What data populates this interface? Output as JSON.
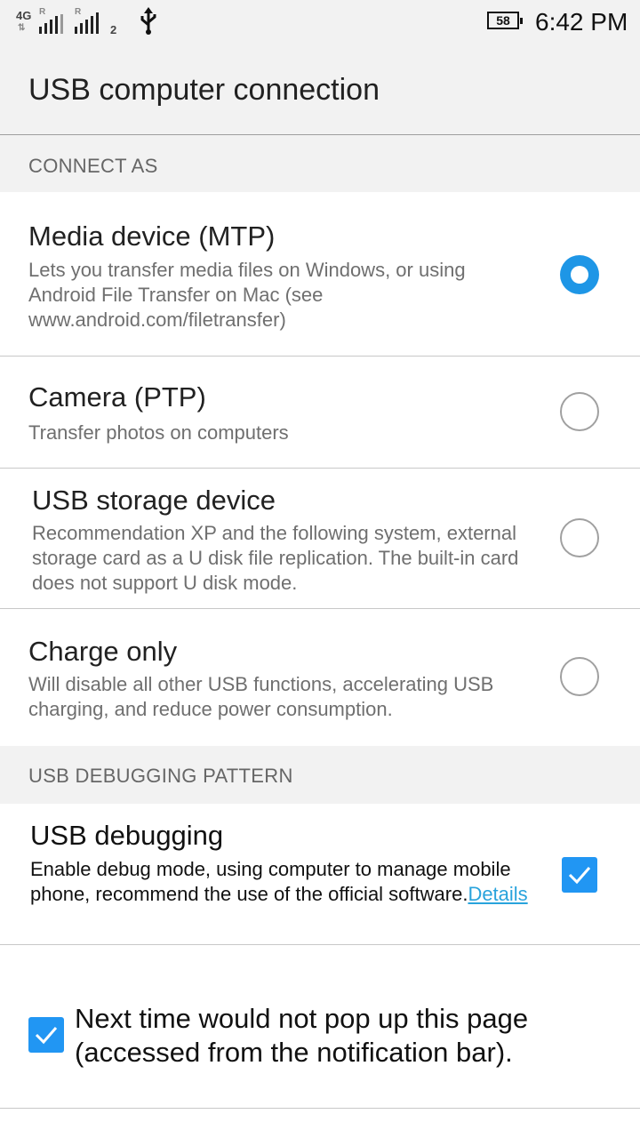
{
  "status_bar": {
    "network1_type": "4G",
    "network1_roaming": "R",
    "network2_roaming": "R",
    "sim2_index": "2",
    "usb_icon": "usb-icon",
    "battery_level": "58",
    "time": "6:42 PM"
  },
  "header": {
    "title": "USB computer connection"
  },
  "connect_as": {
    "label": "CONNECT AS",
    "options": [
      {
        "title": "Media device (MTP)",
        "description": "Lets you transfer media files on Windows, or using Android File Transfer on Mac (see www.android.com/filetransfer)",
        "selected": true
      },
      {
        "title": "Camera (PTP)",
        "description": "Transfer photos on computers",
        "selected": false
      },
      {
        "title": "USB storage device",
        "description": "Recommendation XP and the following system, external storage card as a U disk file replication. The built-in card does not support U disk mode.",
        "selected": false
      },
      {
        "title": "Charge only",
        "description": "Will disable all other USB functions, accelerating USB charging, and reduce power consumption.",
        "selected": false
      }
    ]
  },
  "debug_section": {
    "label": "USB DEBUGGING PATTERN",
    "item": {
      "title": "USB debugging",
      "description": "Enable debug mode, using computer to manage mobile phone, recommend the use of the official software.",
      "link": "Details",
      "checked": true
    }
  },
  "footer_option": {
    "label": "Next time would not pop up this page (accessed from the notification bar).",
    "checked": true
  },
  "colors": {
    "accent": "#2196f3",
    "link": "#29a3dc",
    "section_bg": "#f2f2f2"
  }
}
